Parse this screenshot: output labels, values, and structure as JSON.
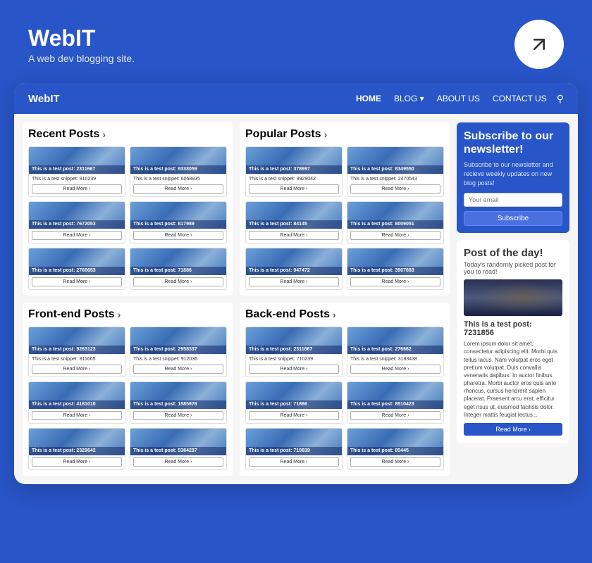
{
  "site": {
    "title": "WebIT",
    "tagline": "A web dev blogging site."
  },
  "nav": {
    "logo": "WebIT",
    "links": [
      {
        "label": "HOME",
        "active": true
      },
      {
        "label": "BLOG ▾",
        "active": false
      },
      {
        "label": "ABOUT US",
        "active": false
      },
      {
        "label": "CONTACT US",
        "active": false
      }
    ]
  },
  "sections": [
    {
      "id": "recent",
      "title": "Recent Posts",
      "posts": [
        {
          "title": "This is a test post: 2311667",
          "snippet": "This is a test snippet: 910239"
        },
        {
          "title": "This is a test post: 9338059",
          "snippet": "This is a test snippet: 6068935"
        },
        {
          "title": "This is a test post: 7672053",
          "snippet": ""
        },
        {
          "title": "This is a test post: 817989",
          "snippet": ""
        },
        {
          "title": "This is a test post: 2766653",
          "snippet": ""
        },
        {
          "title": "This is a test post: 71886",
          "snippet": ""
        }
      ]
    },
    {
      "id": "popular",
      "title": "Popular Posts",
      "posts": [
        {
          "title": "This is a test post: 378697",
          "snippet": "This is a test snippet: 9929042"
        },
        {
          "title": "This is a test post: 8349550",
          "snippet": "This is a test snippet: 2470543"
        },
        {
          "title": "This is a test post: 84145",
          "snippet": ""
        },
        {
          "title": "This is a test post: 8009051",
          "snippet": ""
        },
        {
          "title": "This is a test post: 947472",
          "snippet": ""
        },
        {
          "title": "This is a test post: 3907683",
          "snippet": ""
        }
      ]
    },
    {
      "id": "frontend",
      "title": "Front-end Posts",
      "posts": [
        {
          "title": "This is a test post: 9263123",
          "snippet": "This is a test snippet: 811665"
        },
        {
          "title": "This is a test post: 2958337",
          "snippet": "This is a test snippet: 912036"
        },
        {
          "title": "This is a test post: 4181010",
          "snippet": ""
        },
        {
          "title": "This is a test post: 1585976",
          "snippet": ""
        },
        {
          "title": "This is a test post: 2329642",
          "snippet": ""
        },
        {
          "title": "This is a test post: 5384297",
          "snippet": ""
        }
      ]
    },
    {
      "id": "backend",
      "title": "Back-end Posts",
      "posts": [
        {
          "title": "This is a test post: 2311667",
          "snippet": "This is a test snippet: 710239"
        },
        {
          "title": "This is a test post: 276662",
          "snippet": "This is a test snippet: 3183438"
        },
        {
          "title": "This is a test post: 71866",
          "snippet": ""
        },
        {
          "title": "This is a test post: 8510423",
          "snippet": ""
        },
        {
          "title": "This is a test post: 710839",
          "snippet": ""
        },
        {
          "title": "This is a test post: 85445",
          "snippet": ""
        }
      ]
    }
  ],
  "sidebar": {
    "newsletter": {
      "title": "Subscribe to our newsletter!",
      "subtitle": "Subscribe to our newsletter and recieve weekly updates on new blog posts!",
      "email_placeholder": "Your email",
      "button_label": "Subscribe"
    },
    "potd": {
      "title": "Post of the day!",
      "subtitle": "Today's randomly picked post for you to read!",
      "post_title": "This is a test post: 7231856",
      "post_text": "Lorem ipsum dolor sit amet, consectetur adipiscing elit. Morbi quis tellus lacus. Nam volutpat eros eget pretium volutpat. Duis convallis venenatis dapibus. In auctor finibus pharetra. Morbi auctor eros quis ante rhoncus, cursus hendrerit sapien placerat. Praesent arcu erat, efficitur eget risus ut, euismod facilisis dolor. Integer mattis feugiat lectus...",
      "read_more": "Read More"
    }
  },
  "read_more_label": "Read More"
}
